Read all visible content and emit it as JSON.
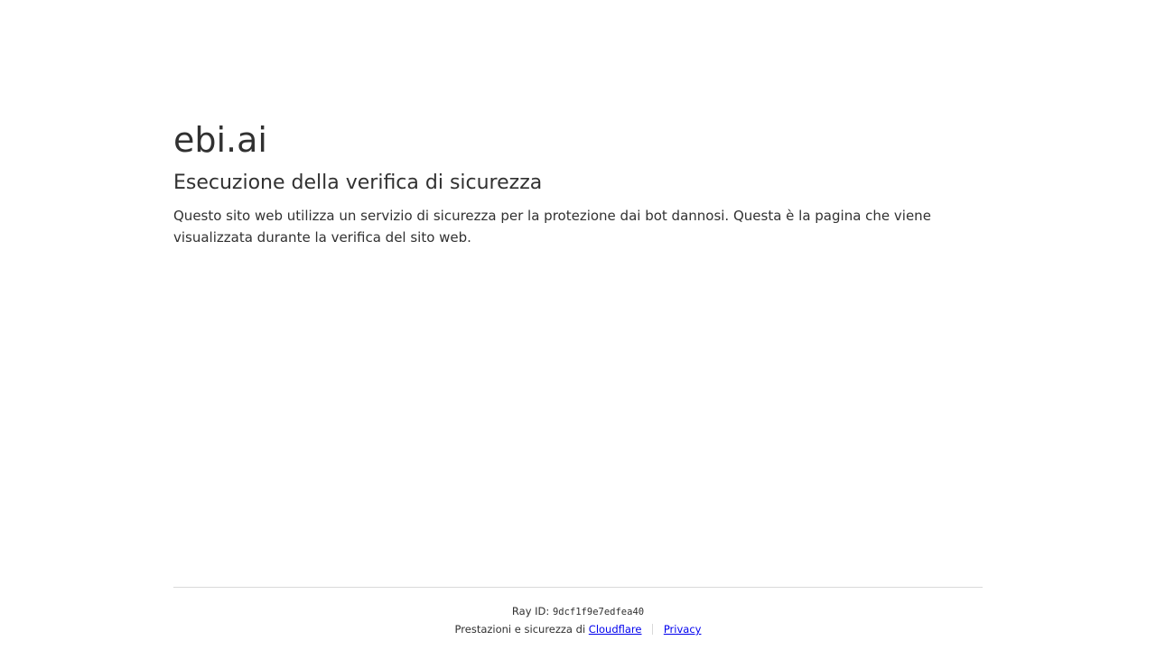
{
  "site": {
    "name": "ebi.ai"
  },
  "main": {
    "heading": "Esecuzione della verifica di sicurezza",
    "description": "Questo sito web utilizza un servizio di sicurezza per la protezione dai bot dannosi. Questa è la pagina che viene visualizzata durante la verifica del sito web."
  },
  "footer": {
    "ray_label": "Ray ID:",
    "ray_id": "9dcf1f9e7edfea40",
    "performance_text": "Prestazioni e sicurezza di",
    "cloudflare_link": "Cloudflare",
    "privacy_link": "Privacy"
  }
}
